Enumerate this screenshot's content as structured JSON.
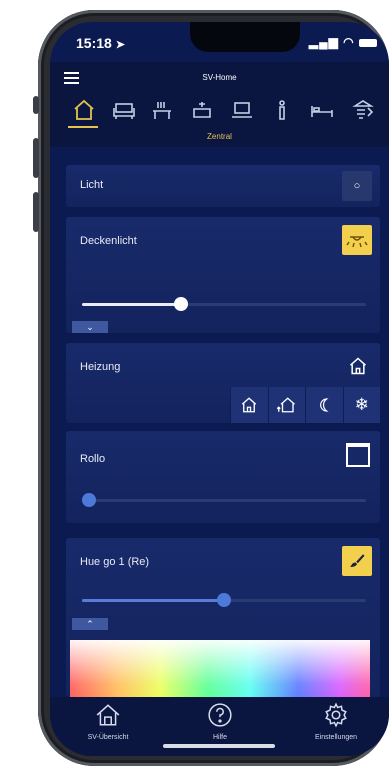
{
  "status": {
    "time": "15:18",
    "signal": "▐▌ ◠ ▬"
  },
  "app": {
    "title": "SV-Home"
  },
  "categories": {
    "icons": [
      "home-icon",
      "sofa-icon",
      "dining-icon",
      "cooking-icon",
      "laptop-icon",
      "bathroom-icon",
      "bed-icon",
      "terrace-icon"
    ],
    "active_index": 0,
    "active_label": "Zentral"
  },
  "cards": {
    "licht": {
      "title": "Licht",
      "button_symbol": "○"
    },
    "deckenlicht": {
      "title": "Deckenlicht",
      "brightness": 0.35
    },
    "heizung": {
      "title": "Heizung",
      "modes": [
        "home-icon",
        "home-arrow-icon",
        "moon-icon",
        "snowflake-icon"
      ]
    },
    "rollo": {
      "title": "Rollo",
      "position": 0.0
    },
    "hue": {
      "title": "Hue go 1 (Re)",
      "brightness": 0.5
    }
  },
  "nav": {
    "overview": "SV-Übersicht",
    "help": "Hilfe",
    "settings": "Einstellungen"
  },
  "colors": {
    "accent": "#f2cf4c",
    "background": "#0c1a52",
    "card": "#182a6a"
  }
}
